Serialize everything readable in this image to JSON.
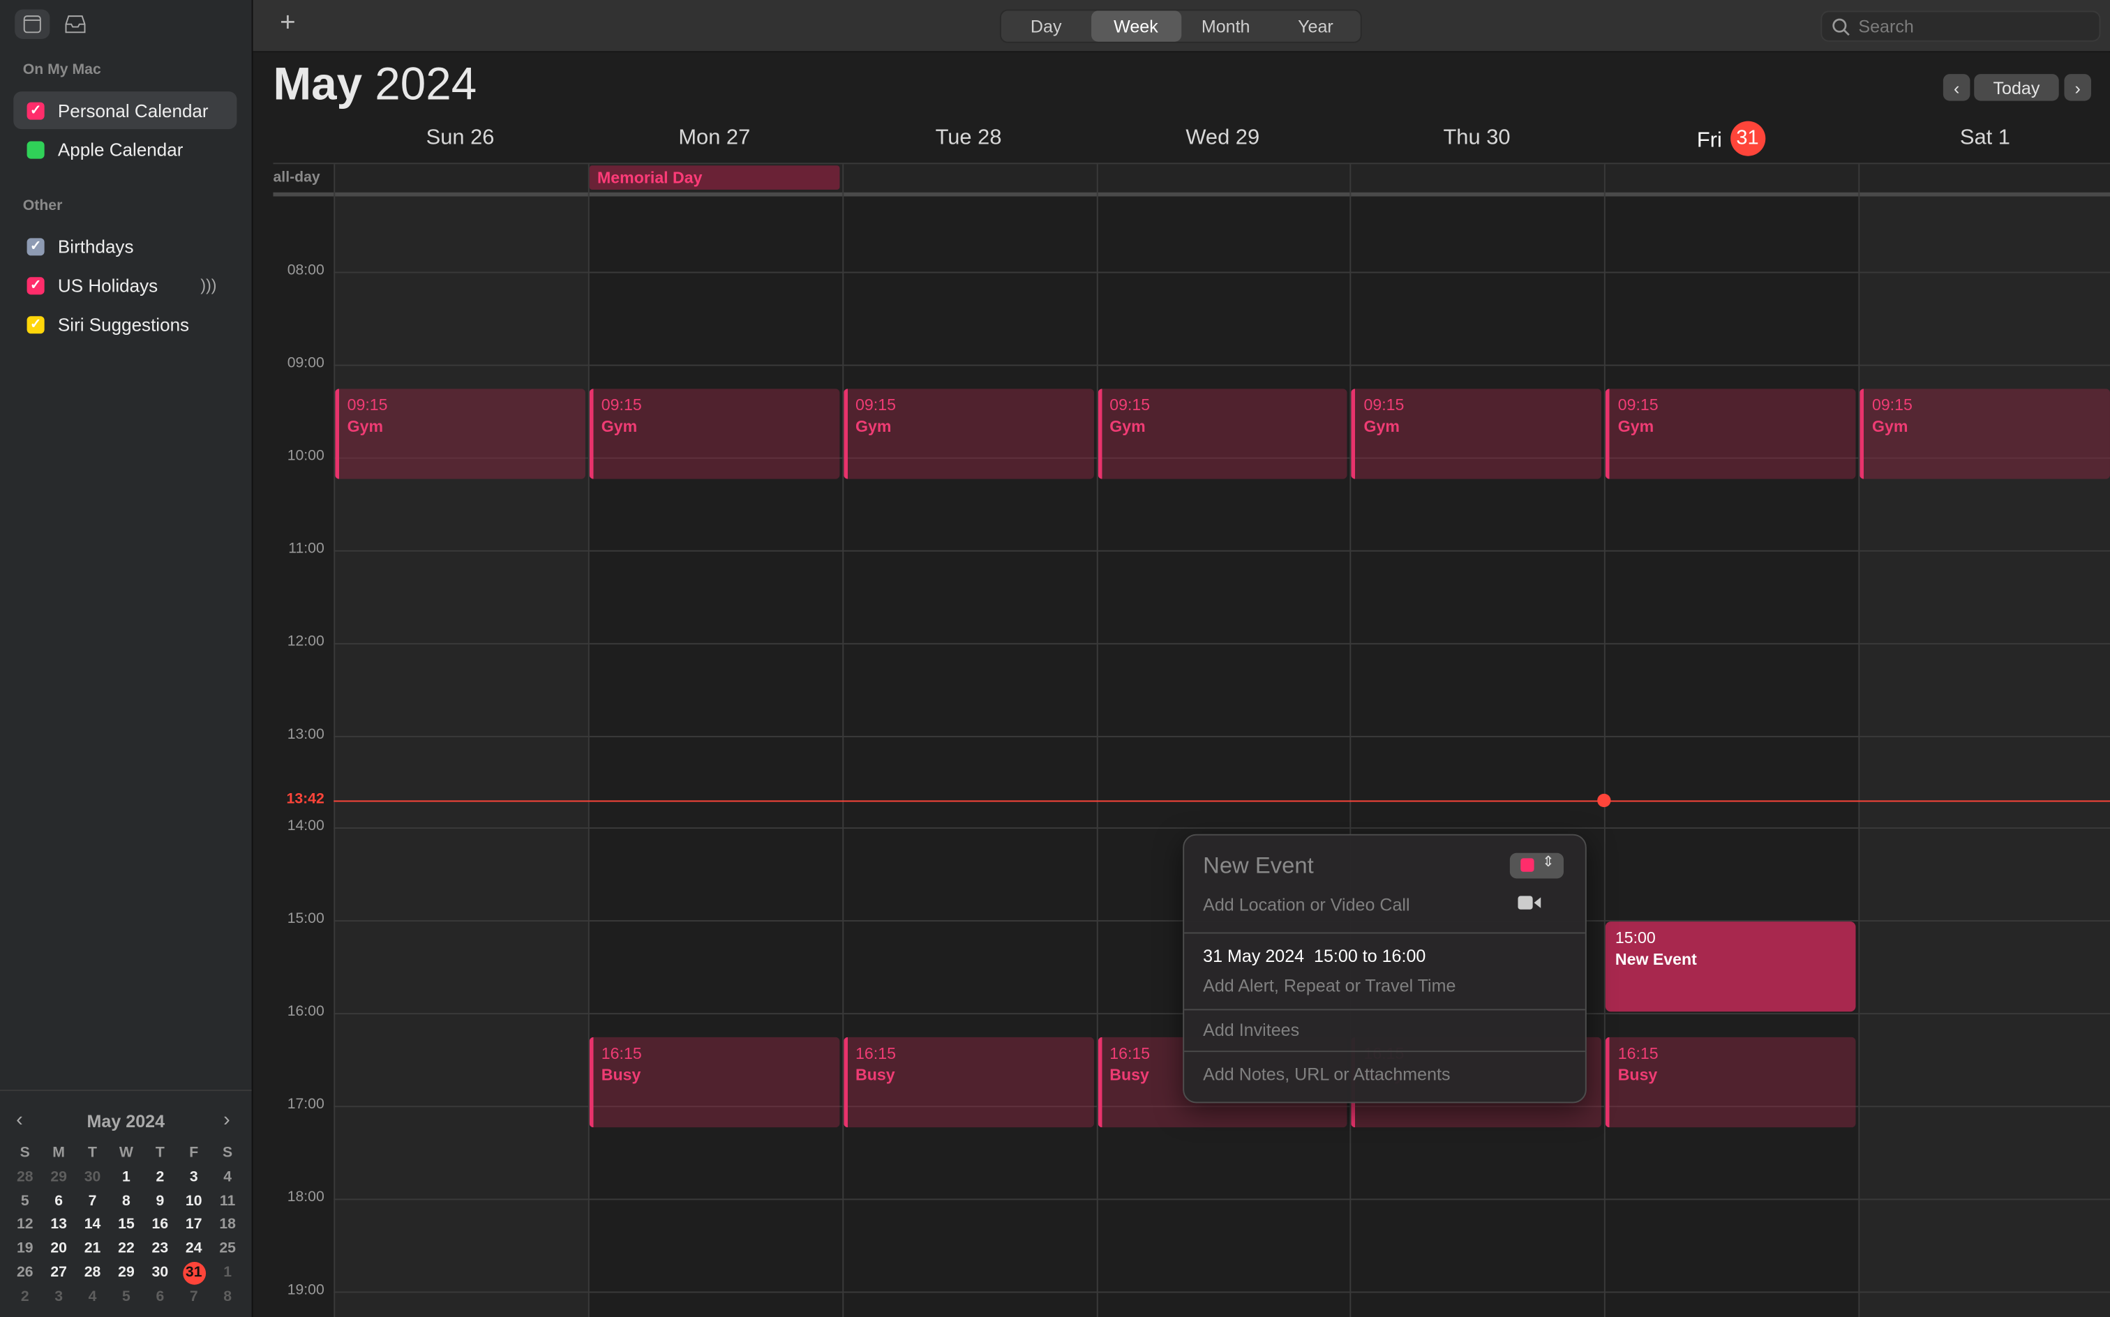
{
  "toolbar": {
    "add_label": "+",
    "views": [
      "Day",
      "Week",
      "Month",
      "Year"
    ],
    "active_view": "Week",
    "search_placeholder": "Search"
  },
  "sidebar": {
    "sections": [
      {
        "title": "On My Mac",
        "items": [
          {
            "label": "Personal Calendar",
            "color": "#ff2d6b",
            "checked": true,
            "selected": true
          },
          {
            "label": "Apple Calendar",
            "color": "#30d158",
            "checked": false
          }
        ]
      },
      {
        "title": "Other",
        "items": [
          {
            "label": "Birthdays",
            "color": "#8e9bb3",
            "checked": true
          },
          {
            "label": "US Holidays",
            "color": "#ff2d6b",
            "checked": true,
            "broadcast": true
          },
          {
            "label": "Siri Suggestions",
            "color": "#ffd60a",
            "checked": true
          }
        ]
      }
    ]
  },
  "mini_calendar": {
    "title": "May 2024",
    "weekdays": [
      "S",
      "M",
      "T",
      "W",
      "T",
      "F",
      "S"
    ],
    "weeks": [
      [
        "28",
        "29",
        "30",
        "1",
        "2",
        "3",
        "4"
      ],
      [
        "5",
        "6",
        "7",
        "8",
        "9",
        "10",
        "11"
      ],
      [
        "12",
        "13",
        "14",
        "15",
        "16",
        "17",
        "18"
      ],
      [
        "19",
        "20",
        "21",
        "22",
        "23",
        "24",
        "25"
      ],
      [
        "26",
        "27",
        "28",
        "29",
        "30",
        "31",
        "1"
      ],
      [
        "2",
        "3",
        "4",
        "5",
        "6",
        "7",
        "8"
      ]
    ],
    "today": "31"
  },
  "header": {
    "month": "May",
    "year": "2024",
    "today_label": "Today"
  },
  "days": [
    {
      "label": "Sun 26"
    },
    {
      "label": "Mon 27"
    },
    {
      "label": "Tue 28"
    },
    {
      "label": "Wed 29"
    },
    {
      "label": "Thu 30"
    },
    {
      "label": "Fri",
      "badge": "31",
      "today": true
    },
    {
      "label": "Sat 1"
    }
  ],
  "allday_label": "all-day",
  "allday_events": [
    {
      "day": 1,
      "title": "Memorial Day"
    }
  ],
  "hours": [
    "08:00",
    "09:00",
    "10:00",
    "11:00",
    "12:00",
    "13:00",
    "14:00",
    "15:00",
    "16:00",
    "17:00",
    "18:00",
    "19:00"
  ],
  "now": "13:42",
  "events": [
    {
      "day": 0,
      "start": "09:15",
      "end": "10:15",
      "title": "Gym"
    },
    {
      "day": 1,
      "start": "09:15",
      "end": "10:15",
      "title": "Gym"
    },
    {
      "day": 2,
      "start": "09:15",
      "end": "10:15",
      "title": "Gym"
    },
    {
      "day": 3,
      "start": "09:15",
      "end": "10:15",
      "title": "Gym"
    },
    {
      "day": 4,
      "start": "09:15",
      "end": "10:15",
      "title": "Gym"
    },
    {
      "day": 5,
      "start": "09:15",
      "end": "10:15",
      "title": "Gym"
    },
    {
      "day": 6,
      "start": "09:15",
      "end": "10:15",
      "title": "Gym"
    },
    {
      "day": 1,
      "start": "16:15",
      "end": "17:15",
      "title": "Busy"
    },
    {
      "day": 2,
      "start": "16:15",
      "end": "17:15",
      "title": "Busy"
    },
    {
      "day": 3,
      "start": "16:15",
      "end": "17:15",
      "title": "Busy"
    },
    {
      "day": 4,
      "start": "16:15",
      "end": "17:15",
      "title": "Busy"
    },
    {
      "day": 5,
      "start": "16:15",
      "end": "17:15",
      "title": "Busy"
    },
    {
      "day": 5,
      "start": "15:00",
      "end": "16:00",
      "title": "New Event",
      "selected": true
    }
  ],
  "popover": {
    "title": "New Event",
    "location_placeholder": "Add Location or Video Call",
    "datetime": "31 May 2024  15:00 to 16:00",
    "alert_placeholder": "Add Alert, Repeat or Travel Time",
    "invitees_placeholder": "Add Invitees",
    "notes_placeholder": "Add Notes, URL or Attachments",
    "calendar_color": "#ff2d6b"
  },
  "colors": {
    "accent": "#ff2d6b",
    "now_line": "#ff453a"
  }
}
